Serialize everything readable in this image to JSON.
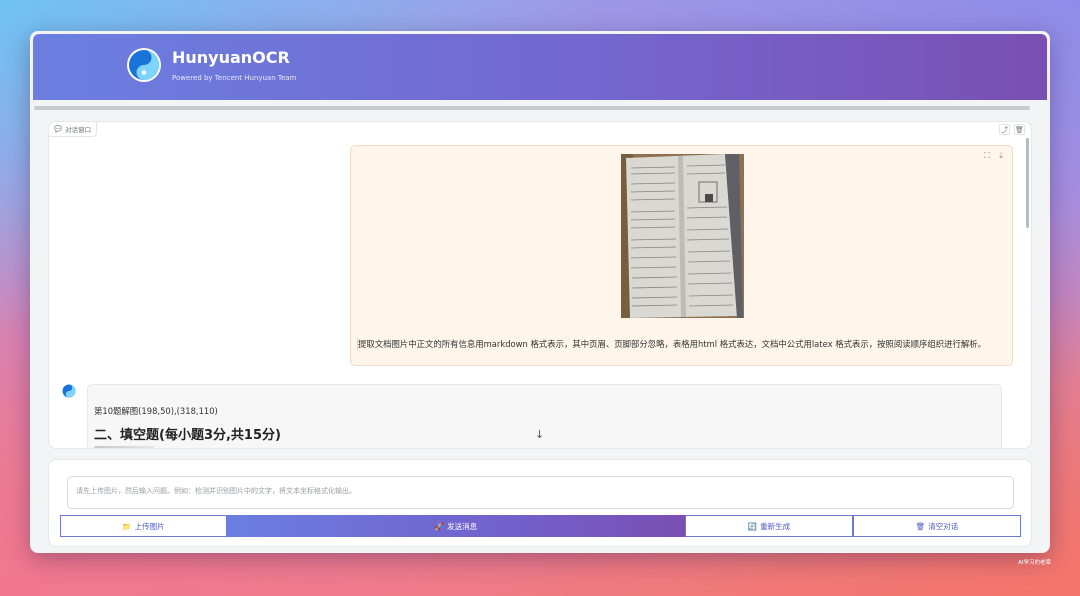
{
  "header": {
    "title": "HunyuanOCR",
    "subtitle": "Powered by Tencent Hunyuan Team",
    "logo_icon": "hunyuan-logo"
  },
  "chat": {
    "label": "对话窗口",
    "label_icon": "chat-bubble-icon",
    "tools": [
      "share-icon",
      "trash-icon"
    ],
    "user_message": {
      "image_alt": "document photo",
      "tools": [
        "fullscreen-icon",
        "download-icon"
      ],
      "text": "提取文档图片中正文的所有信息用markdown 格式表示，其中页眉、页脚部分忽略，表格用html 格式表达，文档中公式用latex 格式表示，按照阅读顺序组织进行解析。"
    },
    "bot_message": {
      "line1": "第10题解图(198,50),(318,110)",
      "heading": "二、填空题(每小题3分,共15分)"
    },
    "scroll_down_glyph": "↓"
  },
  "input": {
    "placeholder": "请先上传图片，然后输入问题。例如：检测并识别图片中的文字，将文本坐标格式化输出。",
    "value": ""
  },
  "buttons": {
    "upload": {
      "icon": "📁",
      "label": "上传图片"
    },
    "send": {
      "icon": "🚀",
      "label": "发送消息"
    },
    "regenerate": {
      "icon": "🔄",
      "label": "重新生成"
    },
    "clear": {
      "icon": "🗑",
      "label": "清空对话"
    }
  },
  "watermark": "AI学习的老章",
  "colors": {
    "accent_start": "#6b7fe0",
    "accent_end": "#7a4fb3",
    "user_bubble": "#fff5ea"
  }
}
